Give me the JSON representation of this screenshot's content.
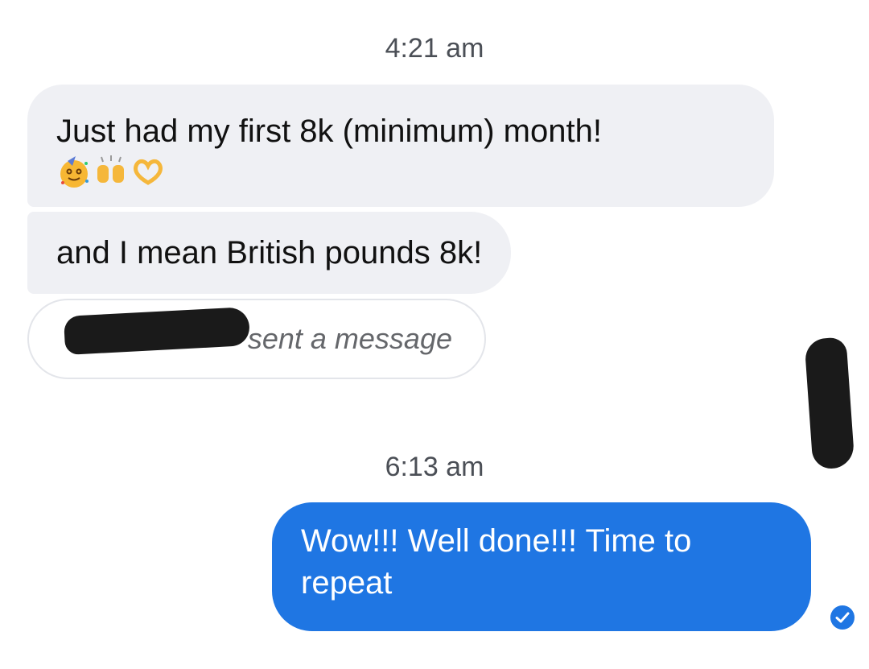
{
  "messages": {
    "time_1": "4:21 am",
    "incoming_1": "Just had my first 8k (minimum) month!",
    "incoming_1_emojis": [
      "partying-face-emoji",
      "raising-hands-emoji",
      "heart-hands-emoji"
    ],
    "incoming_2": "and I mean British pounds 8k!",
    "unsent_notice": "sent a message",
    "time_2": "6:13 am",
    "outgoing_1": "Wow!!! Well done!!! Time to repeat"
  },
  "colors": {
    "incoming_bubble": "#eff0f4",
    "outgoing_bubble": "#1f76e3",
    "seen_indicator": "#1f76e3",
    "redaction": "#1a1a1a"
  },
  "icons": {
    "seen_indicator": "check-circle-icon"
  }
}
